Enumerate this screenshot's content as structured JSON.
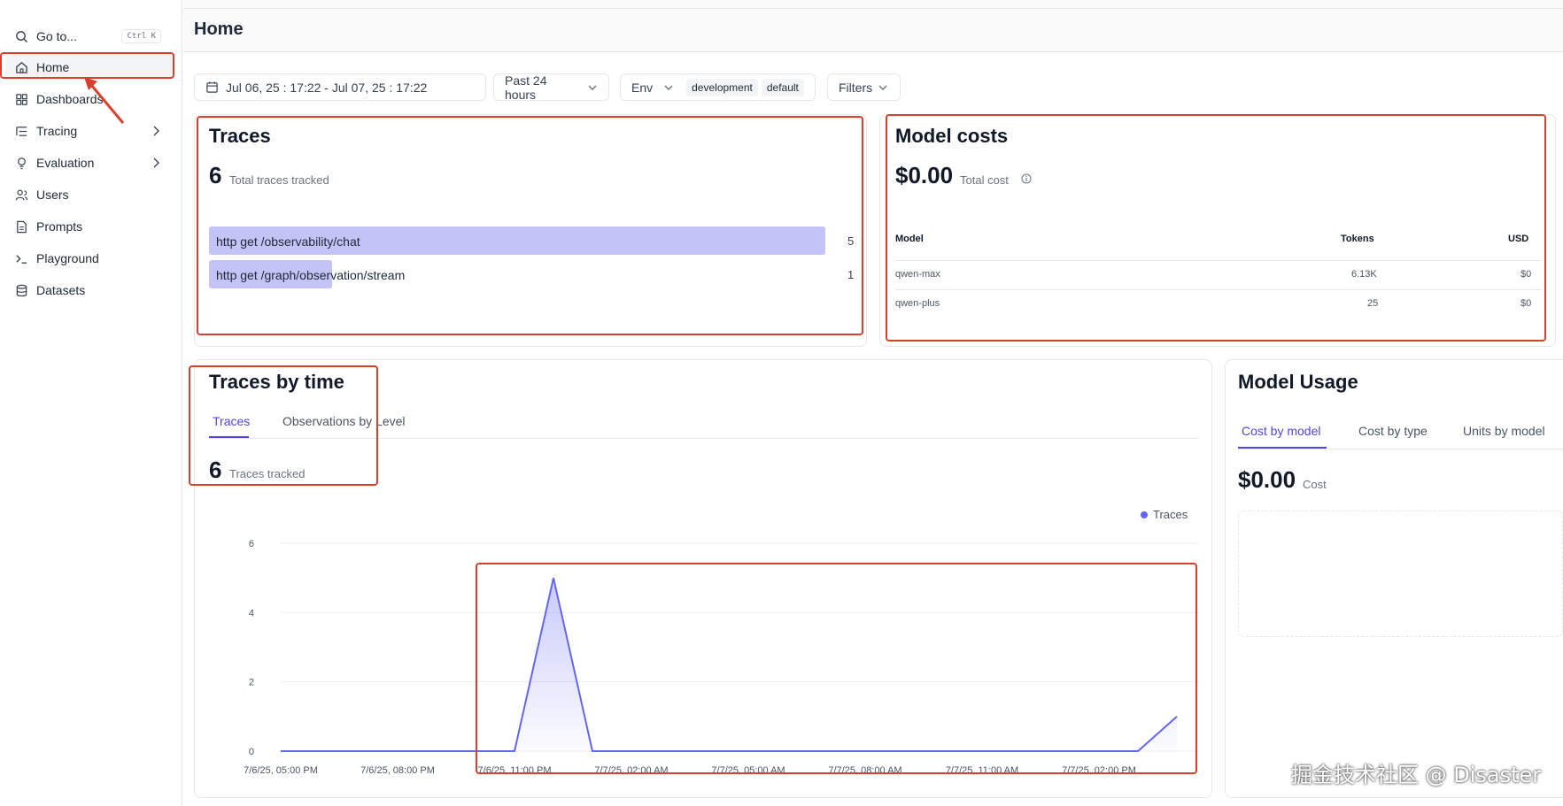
{
  "sidebar": {
    "goto_label": "Go to...",
    "goto_shortcut": "Ctrl K",
    "items": [
      {
        "label": "Home",
        "icon": "home-icon"
      },
      {
        "label": "Dashboards",
        "icon": "dashboard-icon"
      },
      {
        "label": "Tracing",
        "icon": "tracing-icon"
      },
      {
        "label": "Evaluation",
        "icon": "lightbulb-icon"
      },
      {
        "label": "Users",
        "icon": "users-icon"
      },
      {
        "label": "Prompts",
        "icon": "file-icon"
      },
      {
        "label": "Playground",
        "icon": "terminal-icon"
      },
      {
        "label": "Datasets",
        "icon": "database-icon"
      }
    ]
  },
  "header": {
    "title": "Home"
  },
  "filters": {
    "date_range": "Jul 06, 25 : 17:22 - Jul 07, 25 : 17:22",
    "period": "Past 24 hours",
    "env_label": "Env",
    "env_chips": [
      "development",
      "default"
    ],
    "filters_label": "Filters"
  },
  "traces_card": {
    "title": "Traces",
    "total": "6",
    "total_label": "Total traces tracked",
    "rows": [
      {
        "label": "http get /observability/chat",
        "value": 5,
        "value_text": "5"
      },
      {
        "label": "http get /graph/observation/stream",
        "value": 1,
        "value_text": "1"
      }
    ]
  },
  "costs_card": {
    "title": "Model costs",
    "total": "$0.00",
    "total_label": "Total cost",
    "columns": [
      "Model",
      "Tokens",
      "USD"
    ],
    "rows": [
      [
        "qwen-max",
        "6.13K",
        "$0"
      ],
      [
        "qwen-plus",
        "25",
        "$0"
      ]
    ]
  },
  "time_card": {
    "title": "Traces by time",
    "tabs": [
      "Traces",
      "Observations by Level"
    ],
    "total": "6",
    "total_label": "Traces tracked"
  },
  "usage_card": {
    "title": "Model Usage",
    "tabs": [
      "Cost by model",
      "Cost by type",
      "Units by model"
    ],
    "total": "$0.00",
    "total_label": "Cost"
  },
  "chart_data": {
    "type": "area",
    "legend": [
      "Traces"
    ],
    "y_ticks": [
      "6",
      "4",
      "2",
      "0"
    ],
    "ylim": [
      0,
      6
    ],
    "x_ticks": [
      "7/6/25, 05:00 PM",
      "7/6/25, 08:00 PM",
      "7/6/25, 11:00 PM",
      "7/7/25, 02:00 AM",
      "7/7/25, 05:00 AM",
      "7/7/25, 08:00 AM",
      "7/7/25, 11:00 AM",
      "7/7/25, 02:00 PM"
    ],
    "series": [
      {
        "name": "Traces",
        "x_hours": [
          0,
          1,
          2,
          3,
          4,
          5,
          6,
          7,
          8,
          9,
          10,
          11,
          12,
          13,
          14,
          15,
          16,
          17,
          18,
          19,
          20,
          21,
          22,
          23
        ],
        "values": [
          0,
          0,
          0,
          0,
          0,
          0,
          0,
          5,
          0,
          0,
          0,
          0,
          0,
          0,
          0,
          0,
          0,
          0,
          0,
          0,
          0,
          0,
          0,
          1
        ]
      }
    ],
    "color": "#6366f1"
  },
  "watermark": "掘金技术社区 @ Disaster"
}
